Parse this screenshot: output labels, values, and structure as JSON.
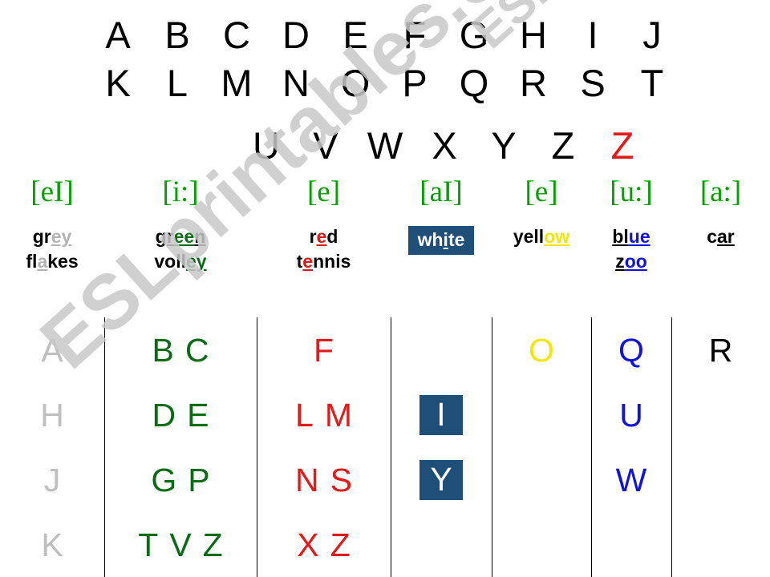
{
  "alphabet": {
    "row1": [
      {
        "letter": "A",
        "color": "black"
      },
      {
        "letter": "B",
        "color": "black"
      },
      {
        "letter": "C",
        "color": "black"
      },
      {
        "letter": "D",
        "color": "black"
      },
      {
        "letter": "E",
        "color": "black"
      },
      {
        "letter": "F",
        "color": "black"
      },
      {
        "letter": "G",
        "color": "black"
      },
      {
        "letter": "H",
        "color": "black"
      },
      {
        "letter": "I",
        "color": "black"
      },
      {
        "letter": "J",
        "color": "black"
      }
    ],
    "row2": [
      {
        "letter": "K",
        "color": "black"
      },
      {
        "letter": "L",
        "color": "black"
      },
      {
        "letter": "M",
        "color": "black"
      },
      {
        "letter": "N",
        "color": "black"
      },
      {
        "letter": "O",
        "color": "black"
      },
      {
        "letter": "P",
        "color": "black"
      },
      {
        "letter": "Q",
        "color": "black"
      },
      {
        "letter": "R",
        "color": "black"
      },
      {
        "letter": "S",
        "color": "black"
      },
      {
        "letter": "T",
        "color": "black"
      }
    ],
    "row3": [
      {
        "letter": "U",
        "color": "black"
      },
      {
        "letter": "V",
        "color": "black"
      },
      {
        "letter": "W",
        "color": "black"
      },
      {
        "letter": "X",
        "color": "black"
      },
      {
        "letter": "Y",
        "color": "black"
      },
      {
        "letter": "Z",
        "color": "black"
      },
      {
        "letter": "Z",
        "color": "red"
      }
    ]
  },
  "columns": [
    {
      "id": "grey",
      "phonetic": "[eI]",
      "words": [
        "grey",
        "flakes"
      ],
      "word_parts": [
        [
          {
            "t": "gr",
            "s": "plain"
          },
          {
            "t": "ey",
            "s": "hl-grey"
          }
        ],
        [
          {
            "t": "fl",
            "s": "plain"
          },
          {
            "t": "a",
            "s": "hl-grey"
          },
          {
            "t": "kes",
            "s": "plain"
          }
        ]
      ],
      "letters_rows": [
        [
          "A"
        ],
        [
          "H"
        ],
        [
          "J"
        ],
        [
          "K"
        ]
      ],
      "letter_color": "c-grey",
      "accent": "#bfbfbf"
    },
    {
      "id": "green",
      "phonetic": "[i:]",
      "words": [
        "green",
        "volley"
      ],
      "word_parts": [
        [
          {
            "t": "gr",
            "s": "u-black"
          },
          {
            "t": "ee",
            "s": "hl-green"
          },
          {
            "t": "n",
            "s": "u-black"
          }
        ],
        [
          {
            "t": "voll",
            "s": "plain"
          },
          {
            "t": "ey",
            "s": "hl-green"
          }
        ]
      ],
      "letters_rows": [
        [
          "B",
          "C"
        ],
        [
          "D",
          "E"
        ],
        [
          "G",
          "P"
        ],
        [
          "T",
          "V",
          "Z"
        ]
      ],
      "letter_color": "c-green",
      "accent": "#0a6b16"
    },
    {
      "id": "red",
      "phonetic": "[e]",
      "words": [
        "red",
        "tennis"
      ],
      "word_parts": [
        [
          {
            "t": "r",
            "s": "plain"
          },
          {
            "t": "e",
            "s": "hl-red"
          },
          {
            "t": "d",
            "s": "plain"
          }
        ],
        [
          {
            "t": "t",
            "s": "plain"
          },
          {
            "t": "e",
            "s": "hl-red"
          },
          {
            "t": "nnis",
            "s": "plain"
          }
        ]
      ],
      "letters_rows": [
        [
          "F"
        ],
        [
          "L",
          "M"
        ],
        [
          "N",
          "S"
        ],
        [
          "X",
          "Z"
        ]
      ],
      "letter_color": "c-red",
      "accent": "#e01b1b"
    },
    {
      "id": "white",
      "phonetic": "[aI]",
      "words": [
        "white"
      ],
      "word_parts": [
        [
          {
            "t": "wh",
            "s": "plain"
          },
          {
            "t": "i",
            "s": "hl-white"
          },
          {
            "t": "te",
            "s": "plain"
          }
        ]
      ],
      "boxed_word": true,
      "letters_rows": [
        [],
        [
          "I"
        ],
        [
          "Y"
        ],
        []
      ],
      "letter_color": "chip-navy",
      "accent": "#1f4e79"
    },
    {
      "id": "yellow",
      "phonetic": "[e]",
      "words": [
        "yellow"
      ],
      "word_parts": [
        [
          {
            "t": "yell",
            "s": "plain"
          },
          {
            "t": "ow",
            "s": "hl-yellow"
          }
        ]
      ],
      "letters_rows": [
        [
          "O"
        ],
        [],
        [],
        []
      ],
      "letter_color": "c-yellow",
      "accent": "#f2e70b"
    },
    {
      "id": "blue",
      "phonetic": "[u:]",
      "words": [
        "blue",
        "zoo"
      ],
      "word_parts": [
        [
          {
            "t": "bl",
            "s": "u-black"
          },
          {
            "t": "ue",
            "s": "hl-blue"
          }
        ],
        [
          {
            "t": "z",
            "s": "u-black"
          },
          {
            "t": "oo",
            "s": "hl-blue"
          }
        ]
      ],
      "letters_rows": [
        [
          "Q"
        ],
        [
          "U"
        ],
        [
          "W"
        ],
        []
      ],
      "letter_color": "c-blue",
      "accent": "#1313d8"
    },
    {
      "id": "black",
      "phonetic": "[a:]",
      "words": [
        "car"
      ],
      "word_parts": [
        [
          {
            "t": "c",
            "s": "plain"
          },
          {
            "t": "ar",
            "s": "hl-black"
          }
        ]
      ],
      "letters_rows": [
        [
          "R"
        ],
        [],
        [],
        []
      ],
      "letter_color": "c-black",
      "accent": "#000000"
    }
  ],
  "watermark": {
    "text_top": "ESLprintables.com",
    "text_bottom": "ESLprintables.com",
    "color": "#c8c8c8"
  }
}
